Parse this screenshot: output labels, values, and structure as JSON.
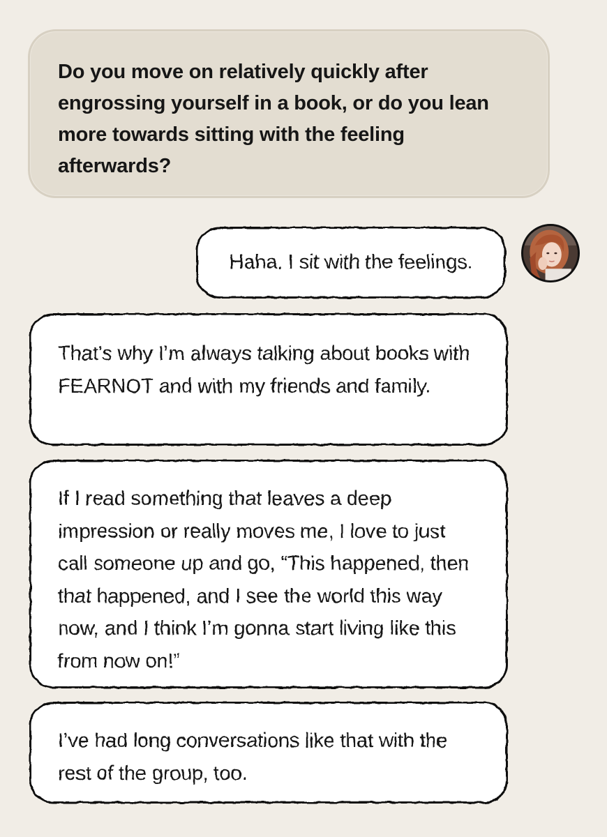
{
  "question": {
    "text": "Do you move on relatively quickly after engrossing yourself in a book, or do you lean more towards sitting with the feeling afterwards?"
  },
  "reply": {
    "text": "Haha. I sit with the feelings.",
    "avatar_icon": "profile-photo-icon"
  },
  "answers": [
    {
      "text": "That’s why I’m always talking about books with FEARNOT and with my friends and family."
    },
    {
      "text": "If I read something that leaves a deep impression or really moves me, I love to just call someone up and go, “This happened, then that happened, and I see the world this way now, and I think I’m gonna start living like this from now on!”"
    },
    {
      "text": "I’ve had long conversations like that with the rest of the group, too."
    }
  ],
  "colors": {
    "background": "#f1ede6",
    "question_bubble": "#e3ddd1",
    "answer_bubble": "#ffffff",
    "outline": "#111111",
    "text": "#161616"
  }
}
